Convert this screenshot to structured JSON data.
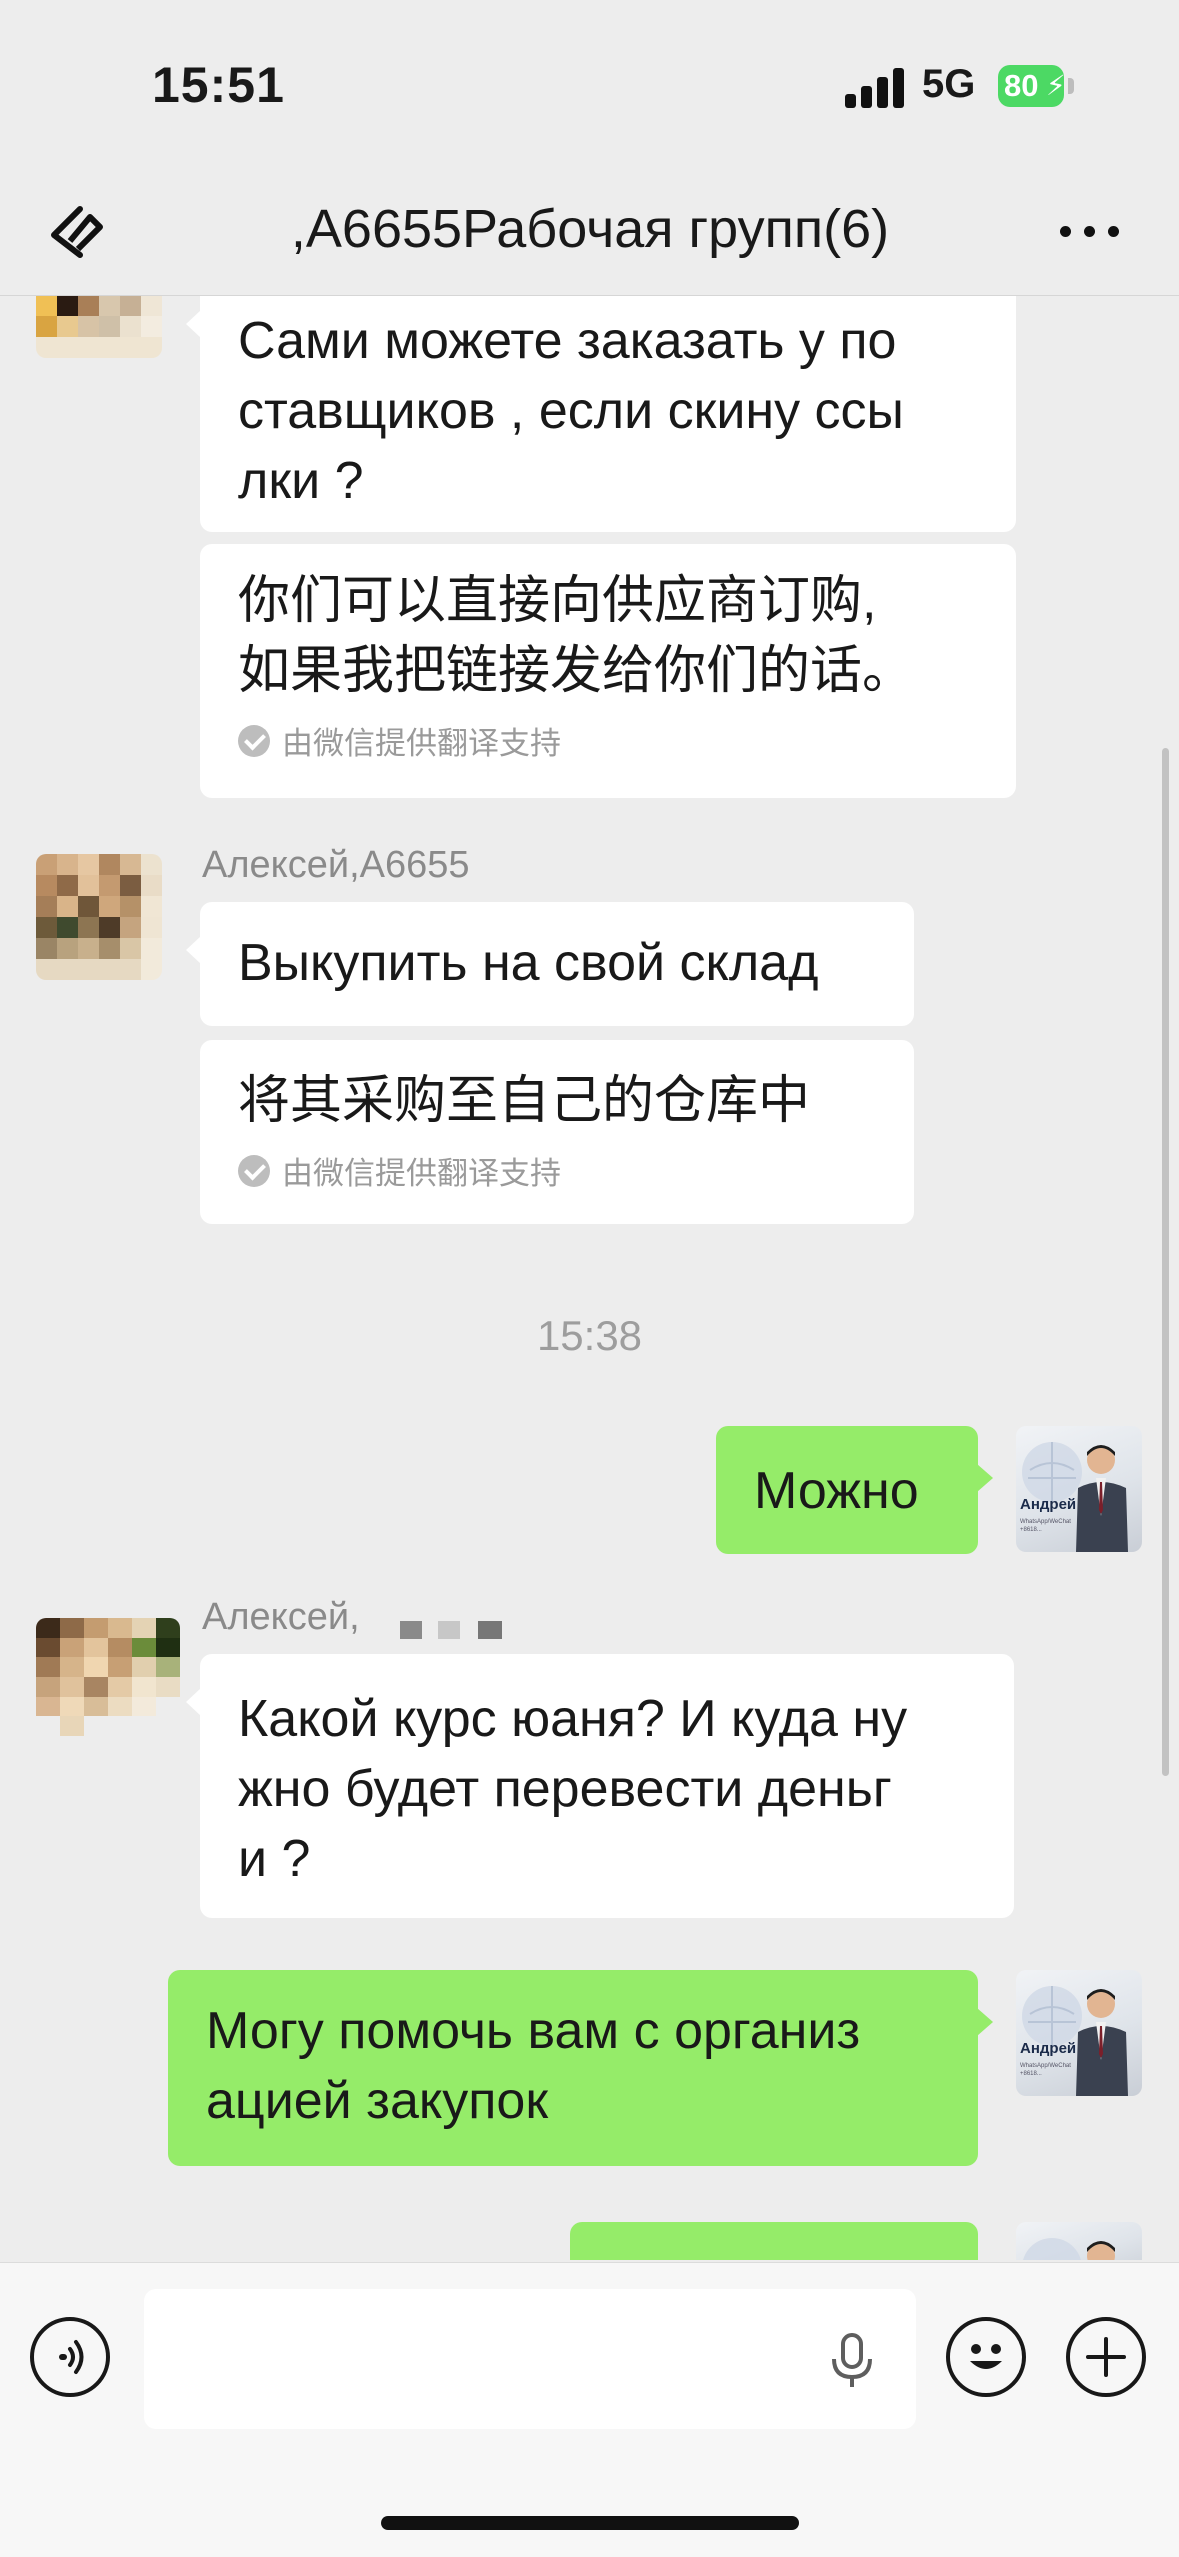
{
  "status_bar": {
    "time": "15:51",
    "network": "5G",
    "battery": "80"
  },
  "nav": {
    "title": ",A6655Рабочая групп(6)",
    "back_icon": "back-arrow-icon",
    "more_icon": "ellipsis-icon"
  },
  "messages": [
    {
      "text": "Сами можете заказать у по\nставщиков , если скину ссы\nлки ?"
    },
    {
      "text": "你们可以直接向供应商订购,\n如果我把链接发给你们的话。",
      "badge": "由微信提供翻译支持"
    },
    {
      "sender": "Алексей,A6655",
      "text": "Выкупить на свой склад"
    },
    {
      "text": "将其采购至自己的仓库中",
      "badge": "由微信提供翻译支持"
    },
    {
      "time": "15:38"
    },
    {
      "text": "Можно",
      "outgoing": true
    },
    {
      "sender": "Алексей,",
      "text": "Какой курс юаня? И куда ну\nжно будет перевести деньг\nи ?"
    },
    {
      "text": "Могу помочь вам с организ\nацией закупок",
      "outgoing": true
    }
  ],
  "my_avatar": {
    "name": "Андрей",
    "caption": "WhatsApp/WeChat +8618..."
  },
  "input": {
    "voice_icon": "voice-icon",
    "mic_icon": "microphone-icon",
    "emoji_icon": "emoji-icon",
    "plus_icon": "plus-icon"
  },
  "colors": {
    "background": "#ededed",
    "incoming_bubble": "#ffffff",
    "outgoing_bubble": "#95ec69",
    "battery": "#4cd964"
  }
}
